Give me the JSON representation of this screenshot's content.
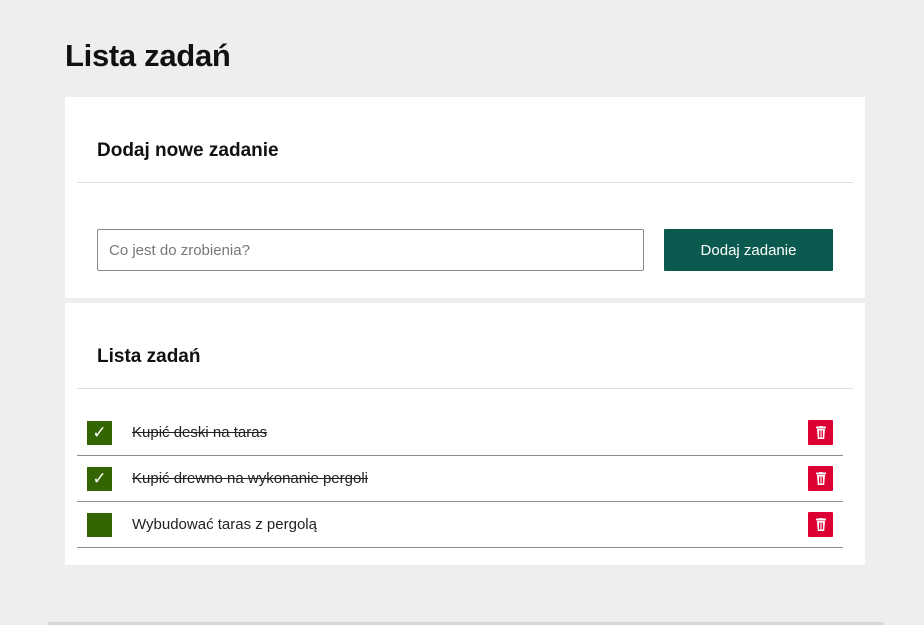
{
  "page": {
    "title": "Lista zadań"
  },
  "add_section": {
    "title": "Dodaj nowe zadanie",
    "input_placeholder": "Co jest do zrobienia?",
    "input_value": "",
    "button_label": "Dodaj zadanie"
  },
  "list_section": {
    "title": "Lista zadań",
    "tasks": [
      {
        "text": "Kupić deski na taras",
        "done": true,
        "check_glyph": "✓"
      },
      {
        "text": "Kupić drewno na wykonanie pergoli",
        "done": true,
        "check_glyph": "✓"
      },
      {
        "text": "Wybudować taras z pergolą",
        "done": false,
        "check_glyph": ""
      }
    ]
  },
  "icons": {
    "checkbox": "check-icon",
    "delete": "trash-icon"
  },
  "colors": {
    "background": "#eeeeee",
    "card": "#ffffff",
    "primary_button": "#0a5a4f",
    "checkbox": "#336600",
    "delete_button": "#dd0033"
  }
}
